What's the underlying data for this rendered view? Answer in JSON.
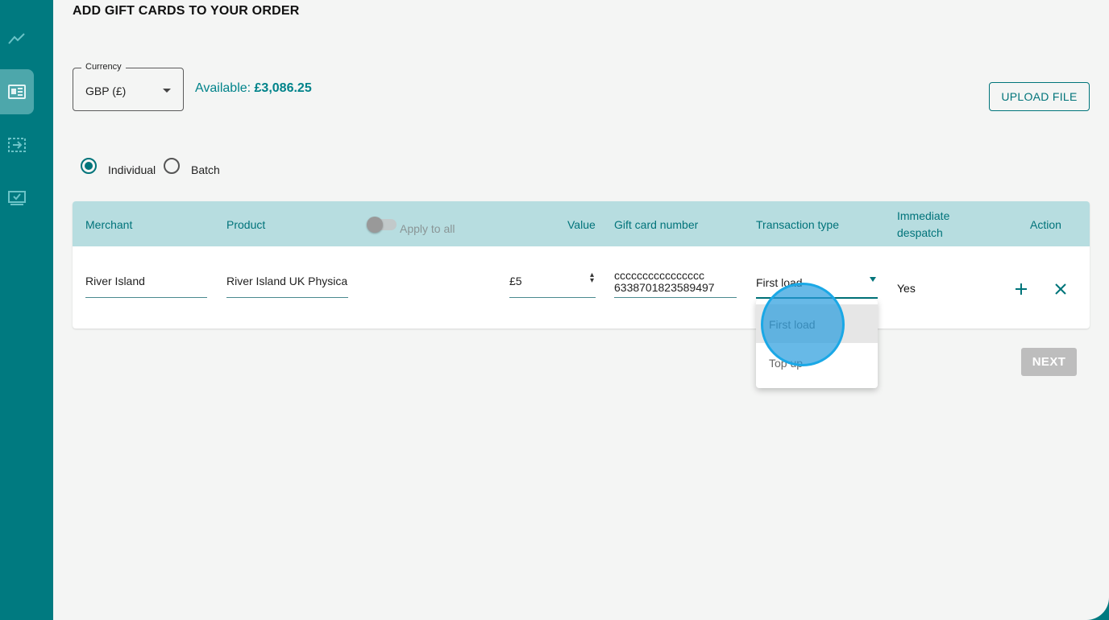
{
  "page": {
    "title": "ADD GIFT CARDS TO YOUR ORDER"
  },
  "sidebar": {
    "items": [
      {
        "icon": "chart-line-icon"
      },
      {
        "icon": "orders-list-icon",
        "active": true
      },
      {
        "icon": "transfer-icon"
      },
      {
        "icon": "checked-screen-icon"
      }
    ]
  },
  "currency": {
    "label": "Currency",
    "value": "GBP (£)"
  },
  "available": {
    "label": "Available: ",
    "amount": "£3,086.25"
  },
  "upload_button": "UPLOAD FILE",
  "mode": {
    "individual": "Individual",
    "batch": "Batch",
    "selected": "Individual"
  },
  "table": {
    "headers": {
      "merchant": "Merchant",
      "product": "Product",
      "apply_all": "Apply to all",
      "value": "Value",
      "card_number": "Gift card number",
      "transaction_type": "Transaction type",
      "despatch_line1": "Immediate",
      "despatch_line2": "despatch",
      "action": "Action"
    },
    "row": {
      "merchant": "River Island",
      "product": "River Island UK Physica",
      "value": "£5",
      "card_number_line1": "cccccccccccccccc",
      "card_number_line2": "6338701823589497",
      "transaction_type": "First load",
      "despatch": "Yes"
    }
  },
  "dropdown": {
    "options": [
      "First load",
      "Top up"
    ]
  },
  "next_button": "NEXT",
  "colors": {
    "brand": "#007a80",
    "header": "#b7dde0",
    "accent": "#00747a",
    "click_indicator": "#1aa8e6"
  }
}
